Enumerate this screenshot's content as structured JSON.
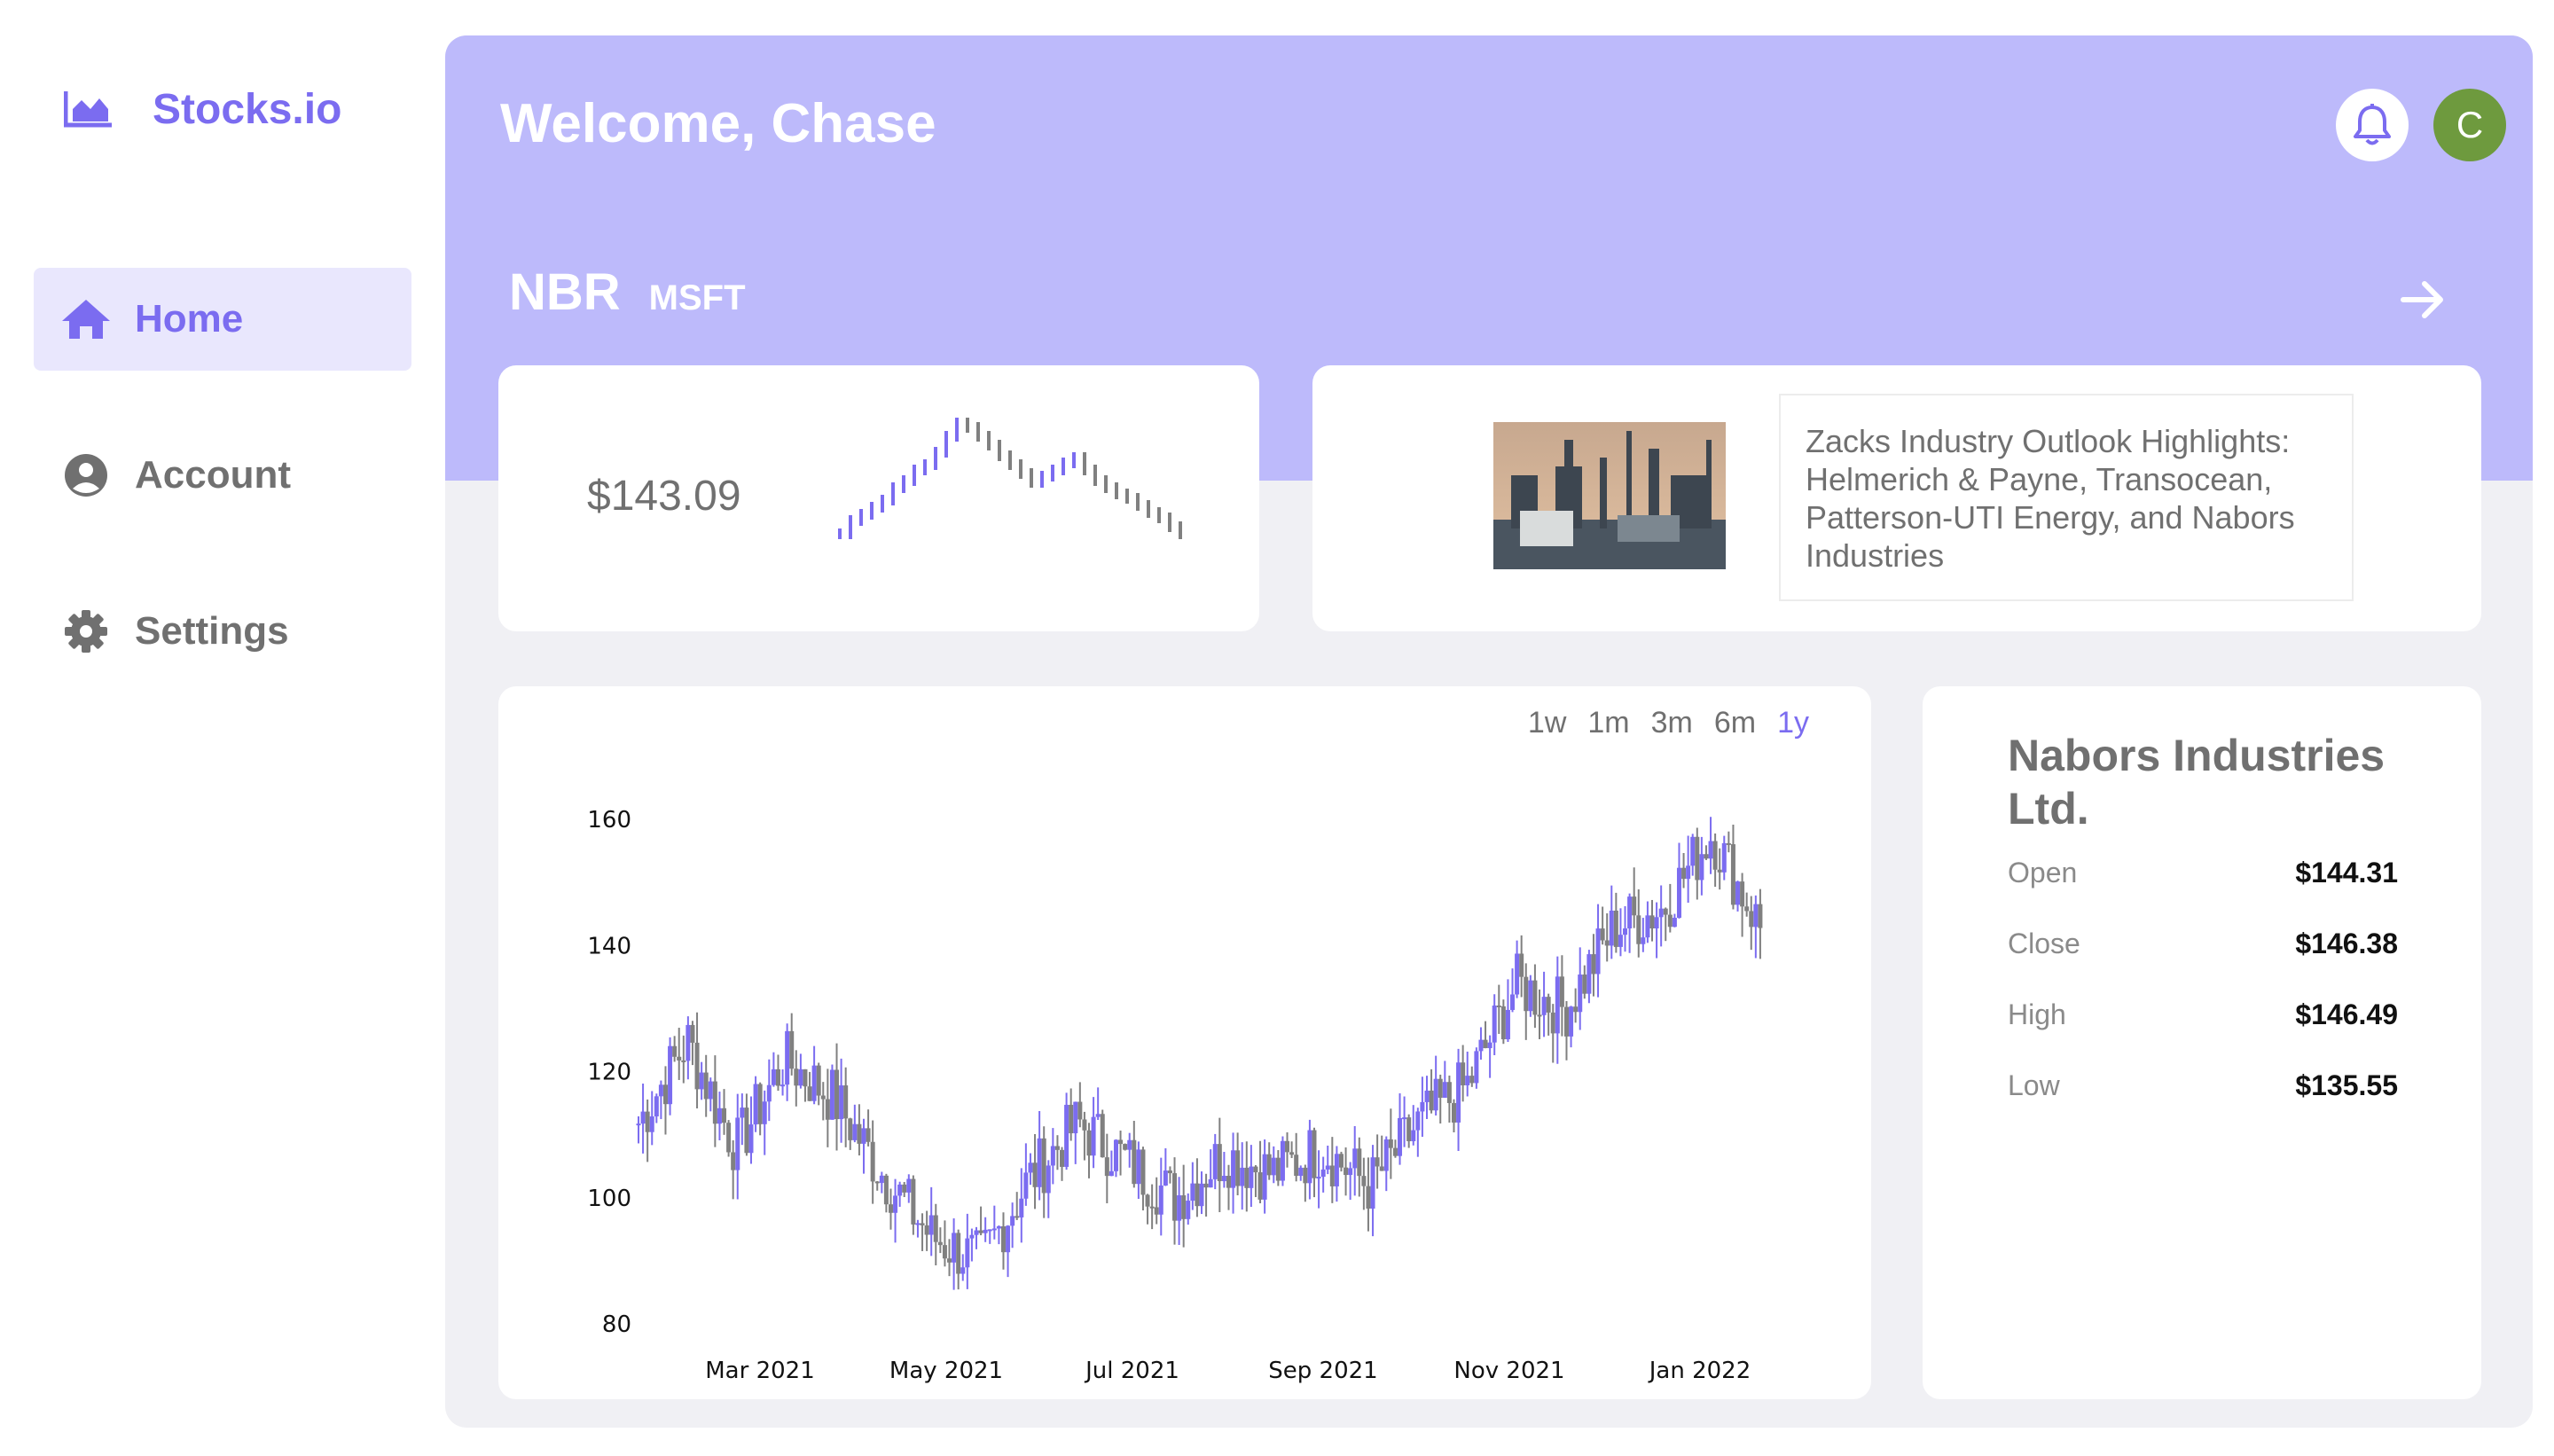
{
  "brand": {
    "name": "Stocks.io",
    "icon": "area-chart-icon",
    "color": "#7b6cf0"
  },
  "nav": [
    {
      "label": "Home",
      "icon": "home-icon",
      "active": true
    },
    {
      "label": "Account",
      "icon": "user-circle-icon",
      "active": false
    },
    {
      "label": "Settings",
      "icon": "gear-icon",
      "active": false
    }
  ],
  "header": {
    "welcome": "Welcome, Chase",
    "avatar_initial": "C",
    "bell_icon": "bell-icon",
    "hero_color": "#bdbafb"
  },
  "tickers": {
    "primary": "NBR",
    "secondary": "MSFT"
  },
  "quote": {
    "price": "$143.09"
  },
  "news": {
    "headline": "Zacks Industry Outlook Highlights: Helmerich & Payne, Transocean, Patterson-UTI Energy, and Nabors Industries",
    "image": "refinery-photo"
  },
  "ranges": [
    {
      "label": "1w",
      "active": false
    },
    {
      "label": "1m",
      "active": false
    },
    {
      "label": "3m",
      "active": false
    },
    {
      "label": "6m",
      "active": false
    },
    {
      "label": "1y",
      "active": true
    }
  ],
  "company": {
    "name": "Nabors Industries Ltd.",
    "stats": [
      {
        "label": "Open",
        "value": "$144.31"
      },
      {
        "label": "Close",
        "value": "$146.38"
      },
      {
        "label": "High",
        "value": "$146.49"
      },
      {
        "label": "Low",
        "value": "$135.55"
      }
    ]
  },
  "chart_data": {
    "type": "candlestick",
    "x_tick_labels": [
      "Mar 2021",
      "May 2021",
      "Jul 2021",
      "Sep 2021",
      "Nov 2021",
      "Jan 2022"
    ],
    "y_ticks": [
      80,
      100,
      120,
      140,
      160
    ],
    "ylim": [
      80,
      170
    ],
    "up_color": "#7b6cf0",
    "down_color": "#808080",
    "x": [
      "2021-02-10",
      "2021-02-25",
      "2021-03-10",
      "2021-03-25",
      "2021-04-10",
      "2021-04-25",
      "2021-05-10",
      "2021-05-25",
      "2021-06-10",
      "2021-06-25",
      "2021-07-10",
      "2021-07-25",
      "2021-08-10",
      "2021-08-25",
      "2021-09-10",
      "2021-09-25",
      "2021-10-10",
      "2021-10-25",
      "2021-11-10",
      "2021-11-25",
      "2021-12-10",
      "2021-12-25",
      "2022-01-10",
      "2022-01-22"
    ],
    "close": [
      112,
      125,
      108,
      122,
      116,
      104,
      94,
      90,
      103,
      112,
      106,
      100,
      107,
      104,
      108,
      102,
      112,
      118,
      134,
      130,
      143,
      146,
      158,
      143
    ]
  }
}
